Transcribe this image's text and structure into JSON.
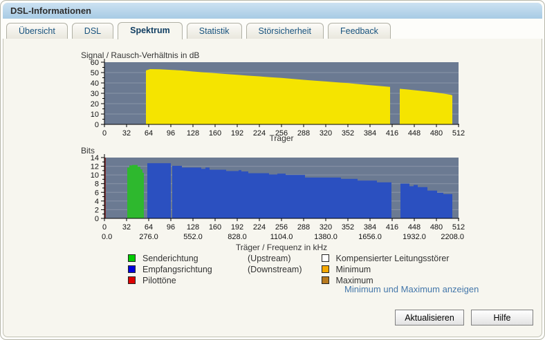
{
  "window": {
    "title": "DSL-Informationen"
  },
  "tabs": [
    {
      "slug": "uebersicht",
      "label": "Übersicht",
      "active": false
    },
    {
      "slug": "dsl",
      "label": "DSL",
      "active": false
    },
    {
      "slug": "spektrum",
      "label": "Spektrum",
      "active": true
    },
    {
      "slug": "statistik",
      "label": "Statistik",
      "active": false
    },
    {
      "slug": "stoersicherheit",
      "label": "Störsicherheit",
      "active": false
    },
    {
      "slug": "feedback",
      "label": "Feedback",
      "active": false
    }
  ],
  "legend": {
    "items_left": [
      {
        "slug": "upstream",
        "label": "Senderichtung",
        "note": "(Upstream)",
        "color": "#00cc00"
      },
      {
        "slug": "downstream",
        "label": "Empfangsrichtung",
        "note": "(Downstream)",
        "color": "#0000dd"
      },
      {
        "slug": "pilottoene",
        "label": "Pilottöne",
        "note": "",
        "color": "#dd0000"
      }
    ],
    "items_right": [
      {
        "slug": "kompensierter-leitungsstoerer",
        "label": "Kompensierter Leitungsstörer",
        "color": "#ffffff"
      },
      {
        "slug": "minimum",
        "label": "Minimum",
        "color": "#f5a800"
      },
      {
        "slug": "maximum",
        "label": "Maximum",
        "color": "#b87a1e"
      }
    ],
    "link": "Minimum und Maximum anzeigen"
  },
  "buttons": {
    "refresh": "Aktualisieren",
    "help": "Hilfe"
  },
  "chart_data": [
    {
      "type": "area",
      "title": "Signal / Rausch-Verhältnis in dB",
      "xlabel": "Träger",
      "xlim": [
        0,
        512
      ],
      "ylim": [
        0,
        60
      ],
      "xticks": [
        0,
        32,
        64,
        96,
        128,
        160,
        192,
        224,
        256,
        288,
        320,
        352,
        384,
        416,
        448,
        480,
        512
      ],
      "yticks": [
        0,
        10,
        20,
        30,
        40,
        50,
        60
      ],
      "ytick_minor_step": 5,
      "grid": true,
      "plot_bg": "#6b7a92",
      "grid_color": "#8a95a8",
      "series": [
        {
          "name": "Signal/Rausch-Verhältnis",
          "color": "#f5e400",
          "segments": [
            {
              "points": [
                [
                  60,
                  52.0
                ],
                [
                  66,
                  53.3
                ],
                [
                  80,
                  53.2
                ],
                [
                  96,
                  52.6
                ],
                [
                  112,
                  52.0
                ],
                [
                  128,
                  51.0
                ],
                [
                  144,
                  50.2
                ],
                [
                  160,
                  49.4
                ],
                [
                  176,
                  48.6
                ],
                [
                  192,
                  47.8
                ],
                [
                  208,
                  47.0
                ],
                [
                  224,
                  46.3
                ],
                [
                  240,
                  45.5
                ],
                [
                  256,
                  44.8
                ],
                [
                  272,
                  43.9
                ],
                [
                  288,
                  43.0
                ],
                [
                  304,
                  42.2
                ],
                [
                  320,
                  41.4
                ],
                [
                  336,
                  40.6
                ],
                [
                  352,
                  39.8
                ],
                [
                  368,
                  38.8
                ],
                [
                  384,
                  37.8
                ],
                [
                  400,
                  36.9
                ],
                [
                  413,
                  36.2
                ]
              ]
            },
            {
              "points": [
                [
                  427,
                  34.3
                ],
                [
                  436,
                  33.8
                ],
                [
                  448,
                  33.0
                ],
                [
                  460,
                  32.2
                ],
                [
                  472,
                  31.3
                ],
                [
                  484,
                  30.3
                ],
                [
                  494,
                  29.3
                ],
                [
                  501,
                  28.5
                ],
                [
                  503,
                  28.0
                ]
              ]
            }
          ]
        }
      ]
    },
    {
      "type": "bar-steps",
      "title": "Bits",
      "xlabel": "Träger / Frequenz in kHz",
      "xlim": [
        0,
        512
      ],
      "ylim": [
        0,
        14
      ],
      "xticks": [
        0,
        32,
        64,
        96,
        128,
        160,
        192,
        224,
        256,
        288,
        320,
        352,
        384,
        416,
        448,
        480,
        512
      ],
      "xticks2": {
        "values": [
          0,
          64,
          128,
          192,
          256,
          320,
          384,
          448,
          512
        ],
        "labels": [
          "0.0",
          "276.0",
          "552.0",
          "828.0",
          "1104.0",
          "1380.0",
          "1656.0",
          "1932.0",
          "2208.0"
        ]
      },
      "yticks": [
        0,
        2,
        4,
        6,
        8,
        10,
        12,
        14
      ],
      "ytick_minor_step": 1,
      "grid": true,
      "plot_bg": "#6b7a92",
      "grid_color": "#8a95a8",
      "pilot_line": {
        "x": 0,
        "color": "#7c1a1a"
      },
      "series": [
        {
          "name": "Senderichtung (Upstream)",
          "color": "#2eb82e",
          "steps": [
            [
              33,
              36,
              11.7
            ],
            [
              36,
              40,
              12.2
            ],
            [
              40,
              48,
              12.3
            ],
            [
              48,
              52,
              11.9
            ],
            [
              52,
              55,
              11.3
            ],
            [
              55,
              57,
              10.5
            ]
          ]
        },
        {
          "name": "Empfangsrichtung (Downstream)",
          "color": "#2b50c0",
          "steps": [
            [
              62,
              96,
              12.7
            ],
            [
              98,
              112,
              12.1
            ],
            [
              112,
              140,
              11.7
            ],
            [
              140,
              146,
              11.4
            ],
            [
              146,
              152,
              11.7
            ],
            [
              152,
              176,
              11.2
            ],
            [
              176,
              194,
              10.9
            ],
            [
              194,
              198,
              11.1
            ],
            [
              198,
              208,
              10.8
            ],
            [
              208,
              238,
              10.4
            ],
            [
              238,
              250,
              10.1
            ],
            [
              250,
              262,
              10.3
            ],
            [
              262,
              290,
              10.0
            ],
            [
              290,
              342,
              9.4
            ],
            [
              342,
              366,
              9.1
            ],
            [
              366,
              394,
              8.7
            ],
            [
              394,
              415,
              8.3
            ],
            [
              428,
              441,
              8.0
            ],
            [
              441,
              447,
              7.4
            ],
            [
              447,
              453,
              7.7
            ],
            [
              453,
              467,
              7.2
            ],
            [
              467,
              481,
              6.4
            ],
            [
              481,
              490,
              5.9
            ],
            [
              490,
              503,
              5.6
            ]
          ]
        }
      ]
    }
  ]
}
